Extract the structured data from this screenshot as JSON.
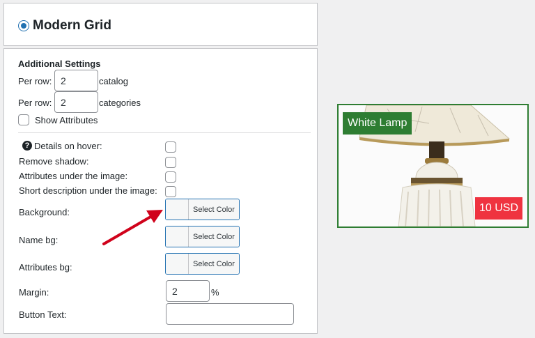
{
  "layout": {
    "title": "Modern Grid"
  },
  "settings": {
    "heading": "Additional Settings",
    "per_row_catalog": {
      "label": "Per row:",
      "value": "2",
      "suffix": "catalog"
    },
    "per_row_categories": {
      "label": "Per row:",
      "value": "2",
      "suffix": "categories"
    },
    "show_attributes": {
      "label": "Show Attributes"
    },
    "details_on_hover": {
      "label": "Details on hover:"
    },
    "remove_shadow": {
      "label": "Remove shadow:"
    },
    "attributes_under_image": {
      "label": "Attributes under the image:"
    },
    "short_description": {
      "label": "Short description under the image:"
    },
    "background": {
      "label": "Background:",
      "button": "Select Color"
    },
    "name_bg": {
      "label": "Name bg:",
      "button": "Select Color"
    },
    "attributes_bg": {
      "label": "Attributes bg:",
      "button": "Select Color"
    },
    "margin": {
      "label": "Margin:",
      "value": "2",
      "unit": "%"
    },
    "button_text": {
      "label": "Button Text:",
      "value": ""
    }
  },
  "preview": {
    "name": "White Lamp",
    "price": "10 USD",
    "colors": {
      "name_bg": "#2e7d32",
      "price_bg": "#ef3340",
      "border": "#2e7d32"
    }
  },
  "annotation": {
    "arrow_color": "#d0021b"
  }
}
